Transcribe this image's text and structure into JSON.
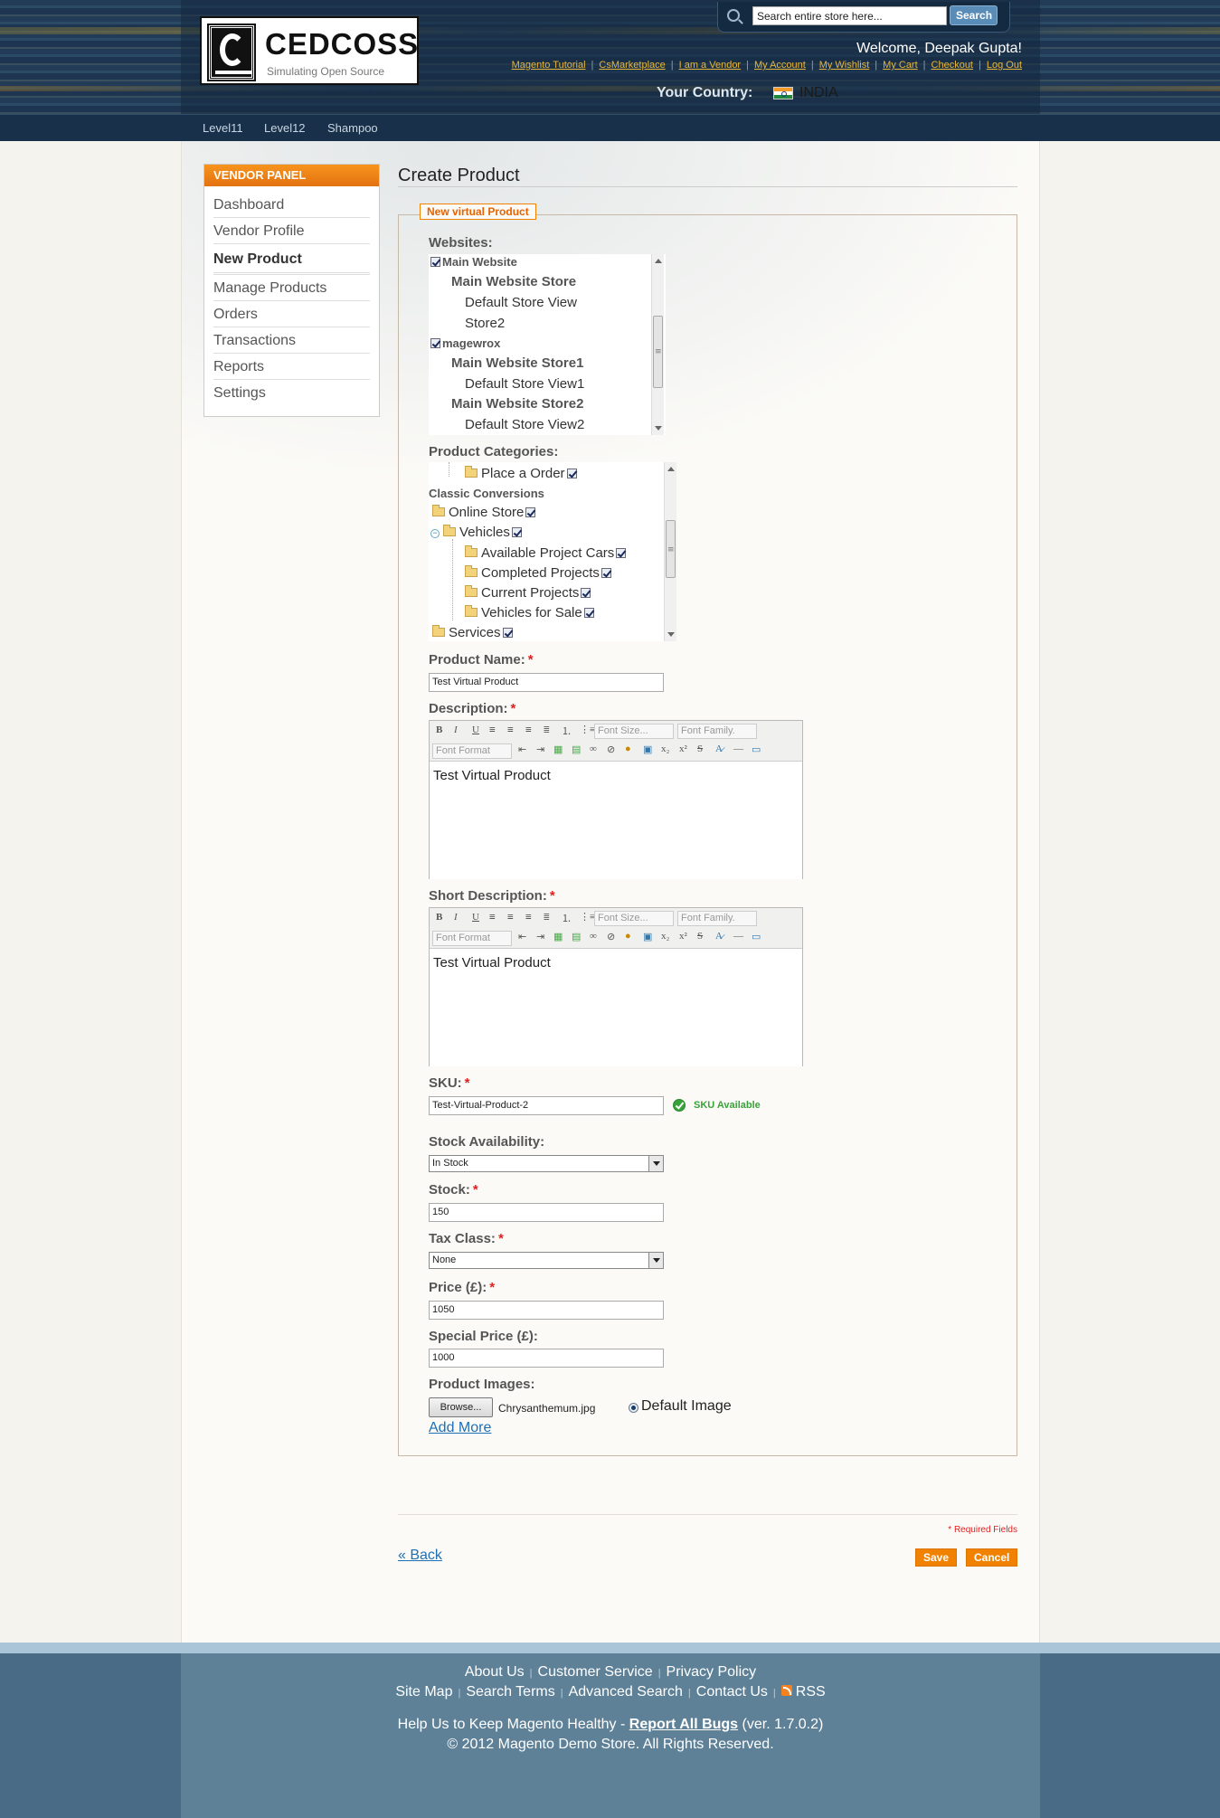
{
  "header": {
    "logo_name": "CEDCOSS",
    "logo_tagline": "Simulating Open Source",
    "search_placeholder": "Search entire store here...",
    "search_button": "Search",
    "welcome": "Welcome, Deepak Gupta!",
    "links": [
      "Magento Tutorial",
      "CsMarketplace",
      "I am a Vendor",
      "My Account",
      "My Wishlist",
      "My Cart",
      "Checkout",
      "Log Out"
    ],
    "country_label": "Your Country:",
    "country_name": "INDIA",
    "nav": [
      "Level11",
      "Level12",
      "Shampoo"
    ]
  },
  "sidebar": {
    "title": "VENDOR PANEL",
    "items": [
      {
        "label": "Dashboard"
      },
      {
        "label": "Vendor Profile"
      },
      {
        "label": "New Product",
        "active": true
      },
      {
        "label": "Manage Products"
      },
      {
        "label": "Orders"
      },
      {
        "label": "Transactions"
      },
      {
        "label": "Reports"
      },
      {
        "label": "Settings"
      }
    ]
  },
  "page": {
    "title": "Create Product",
    "legend": "New virtual Product"
  },
  "websites": {
    "label": "Websites:",
    "items": [
      "Main Website",
      "Main Website Store",
      "Default Store View",
      "Store2",
      "magewrox",
      "Main Website Store1",
      "Default Store View1",
      "Main Website Store2",
      "Default Store View2"
    ]
  },
  "categories": {
    "label": "Product Categories:",
    "items": [
      "Place a Order",
      "Classic Conversions",
      "Online Store",
      "Vehicles",
      "Available Project Cars",
      "Completed Projects",
      "Current Projects",
      "Vehicles for Sale",
      "Services"
    ]
  },
  "form": {
    "product_name_label": "Product Name:",
    "product_name_value": "Test Virtual Product",
    "description_label": "Description:",
    "description_value": "Test Virtual Product",
    "short_description_label": "Short Description:",
    "short_description_value": "Test Virtual Product",
    "editor_font_size": "Font Size...",
    "editor_font_family": "Font Family.",
    "editor_font_format": "Font Format",
    "sku_label": "SKU:",
    "sku_value": "Test-Virtual-Product-2",
    "sku_status": "SKU Available",
    "stock_availability_label": "Stock Availability:",
    "stock_availability_value": "In Stock",
    "stock_label": "Stock:",
    "stock_value": "150",
    "tax_class_label": "Tax Class:",
    "tax_class_value": "None",
    "price_label": "Price (£):",
    "price_value": "1050",
    "special_price_label": "Special Price (£):",
    "special_price_value": "1000",
    "images_label": "Product Images:",
    "browse_button": "Browse...",
    "file_name": "Chrysanthemum.jpg",
    "default_image_label": "Default Image",
    "add_more": "Add More"
  },
  "actions": {
    "required_note": "* Required Fields",
    "back": "« Back",
    "save": "Save",
    "cancel": "Cancel"
  },
  "footer": {
    "row1": [
      "About Us",
      "Customer Service",
      "Privacy Policy"
    ],
    "row2": [
      "Site Map",
      "Search Terms",
      "Advanced Search",
      "Contact Us",
      "RSS"
    ],
    "help_prefix": "Help Us to Keep Magento Healthy -",
    "report_bugs": "Report All Bugs",
    "version": "(ver. 1.7.0.2)",
    "copyright": "© 2012 Magento Demo Store. All Rights Reserved."
  },
  "colors": {
    "accent": "#f18200",
    "header": "#1f3a55",
    "link": "#1f6fb5",
    "footer": "#5e8198"
  }
}
